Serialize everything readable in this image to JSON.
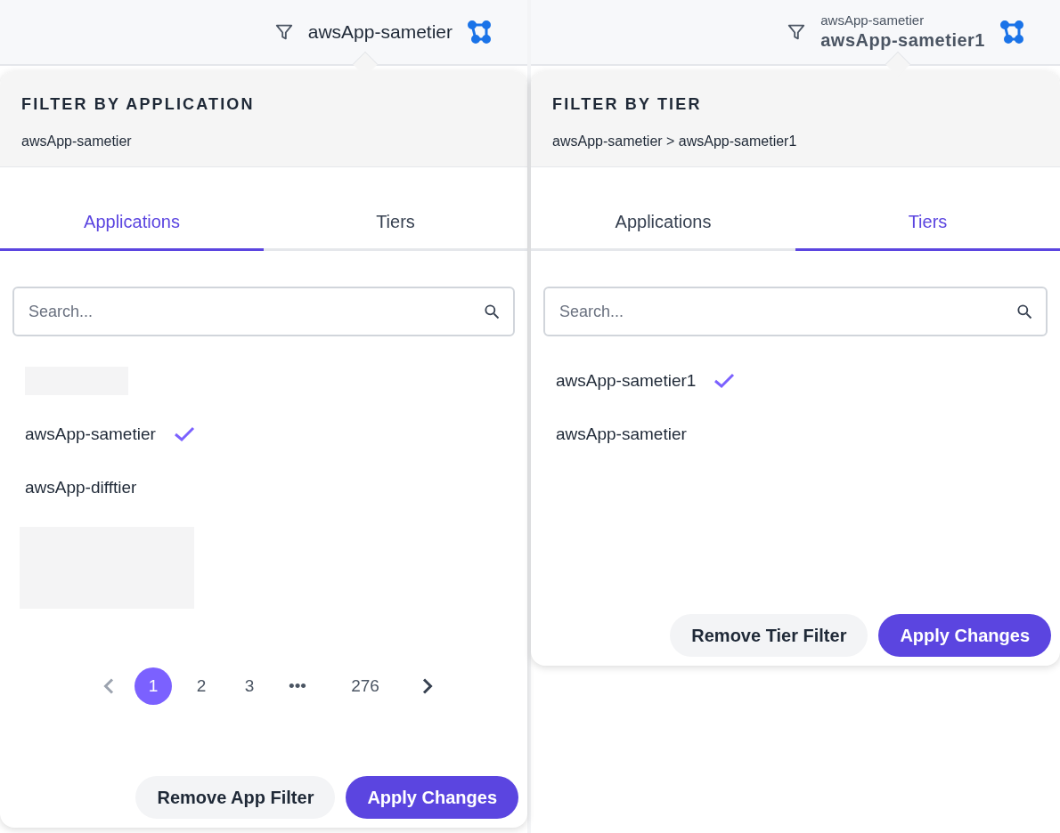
{
  "panels": [
    {
      "topbar": {
        "title": "awsApp-sametier"
      },
      "heading": "FILTER BY APPLICATION",
      "path": "awsApp-sametier",
      "tabs": [
        {
          "label": "Applications",
          "selected": true
        },
        {
          "label": "Tiers",
          "selected": false
        }
      ],
      "search": {
        "placeholder": "Search..."
      },
      "items": [
        {
          "kind": "skeleton_line"
        },
        {
          "kind": "option",
          "label": "awsApp-sametier",
          "checked": true
        },
        {
          "kind": "option",
          "label": "awsApp-difftier",
          "checked": false
        },
        {
          "kind": "skeleton_block"
        }
      ],
      "pagination": {
        "prev_disabled": true,
        "next_disabled": false,
        "pages": [
          {
            "label": "1",
            "selected": true
          },
          {
            "label": "2",
            "selected": false
          },
          {
            "label": "3",
            "selected": false
          },
          {
            "label": "•••",
            "selected": false
          },
          {
            "label": "276",
            "selected": false
          }
        ]
      },
      "buttons": [
        {
          "label": "Remove App Filter",
          "kind": "secondary"
        },
        {
          "label": "Apply Changes",
          "kind": "primary"
        }
      ]
    },
    {
      "topbar": {
        "subtitle": "awsApp-sametier",
        "title": "awsApp-sametier1"
      },
      "heading": "FILTER BY TIER",
      "path": "awsApp-sametier > awsApp-sametier1",
      "tabs": [
        {
          "label": "Applications",
          "selected": false
        },
        {
          "label": "Tiers",
          "selected": true
        }
      ],
      "search": {
        "placeholder": "Search..."
      },
      "items": [
        {
          "kind": "option",
          "label": "awsApp-sametier1",
          "checked": true
        },
        {
          "kind": "option",
          "label": "awsApp-sametier",
          "checked": false
        }
      ],
      "buttons": [
        {
          "label": "Remove Tier Filter",
          "kind": "secondary"
        },
        {
          "label": "Apply Changes",
          "kind": "primary"
        }
      ]
    }
  ]
}
